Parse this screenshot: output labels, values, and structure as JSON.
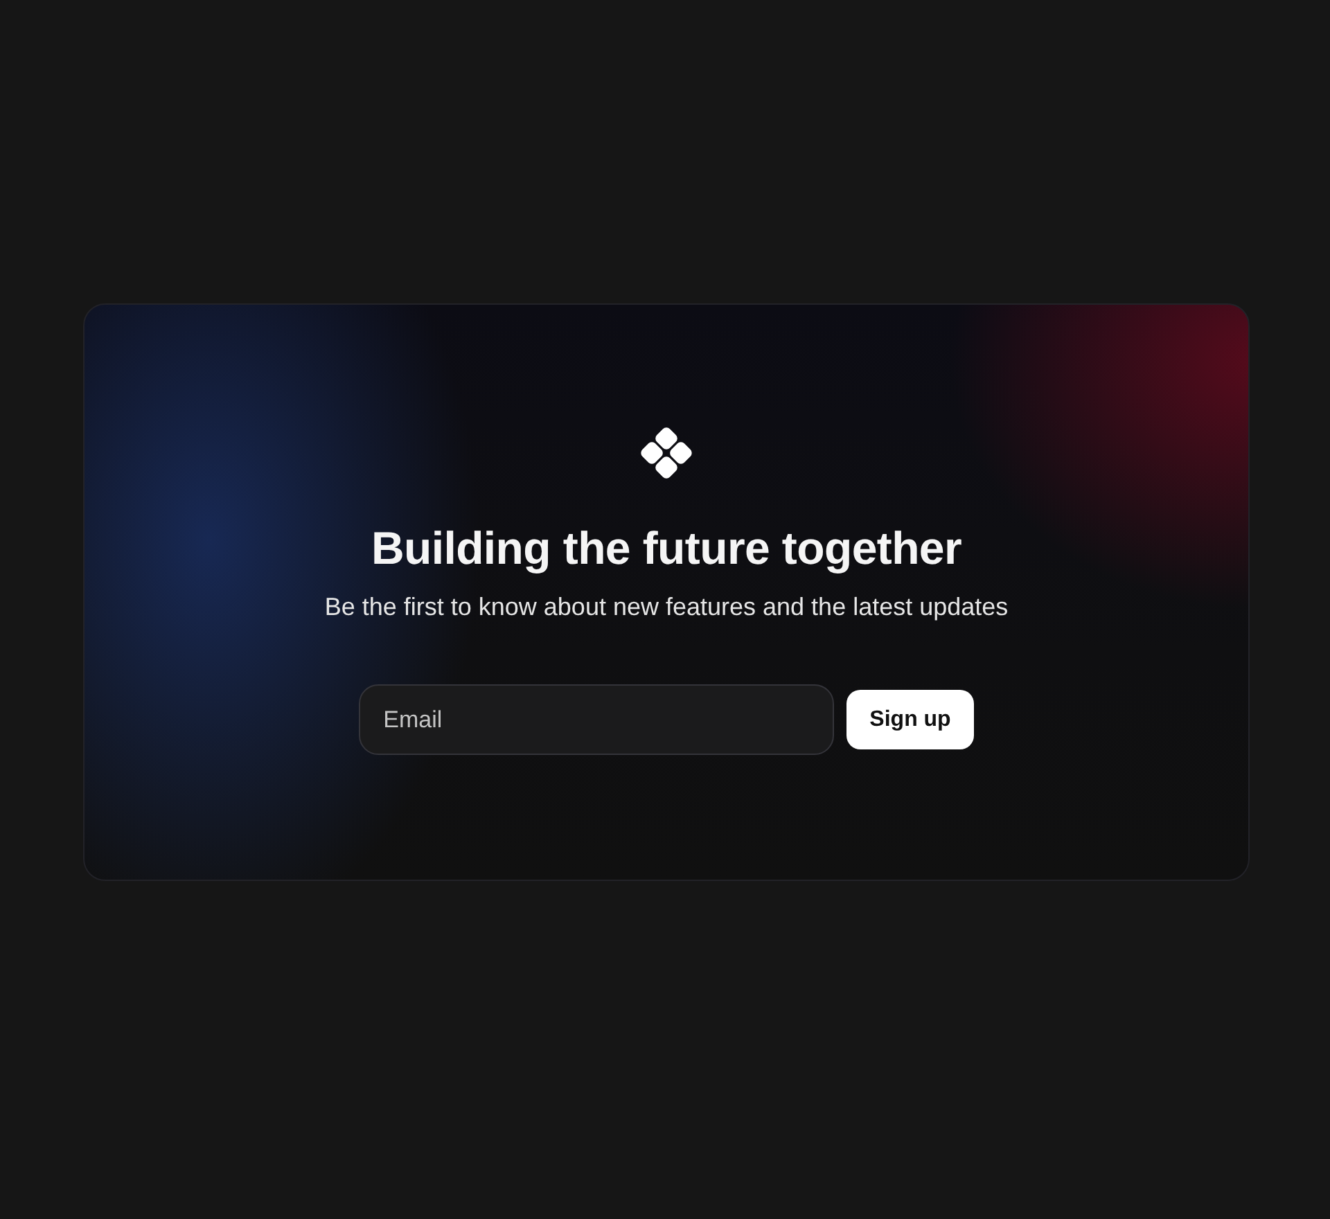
{
  "hero": {
    "title": "Building the future together",
    "subtitle": "Be the first to know about new features and the latest updates"
  },
  "signup": {
    "email": {
      "placeholder": "Email"
    },
    "button": "Sign up"
  }
}
